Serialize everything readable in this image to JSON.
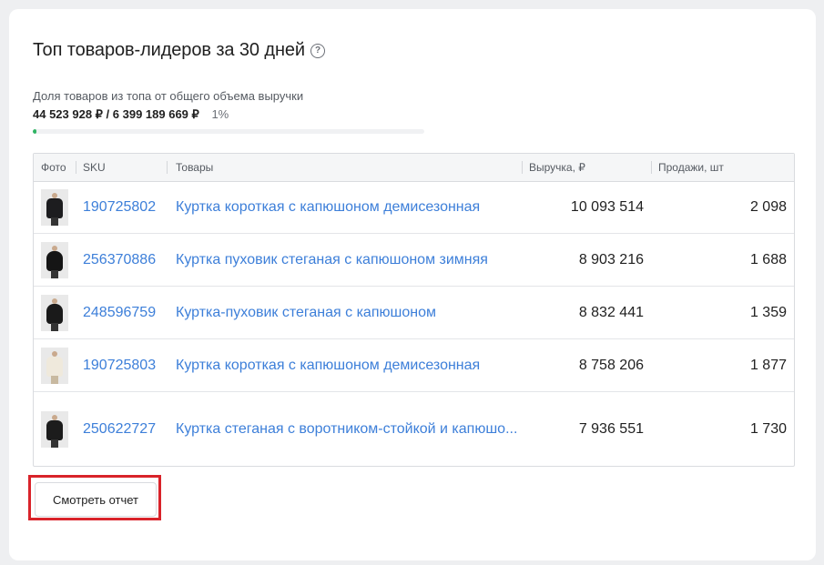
{
  "widget": {
    "title": "Топ товаров-лидеров за 30 дней",
    "help_icon": "question-circle-icon",
    "share_label": "Доля товаров из топа от общего объема выручки",
    "share_amount": "44 523 928 ₽ / 6 399 189 669 ₽",
    "share_percent": "1%",
    "share_fraction": 0.01,
    "accent_color": "#2fb463"
  },
  "table": {
    "columns": [
      "Фото",
      "SKU",
      "Товары",
      "Выручка, ₽",
      "Продажи, шт"
    ],
    "rows": [
      {
        "photo": "black-jacket-photo",
        "sku": "190725802",
        "name": "Куртка короткая с капюшоном демисезонная",
        "revenue": "10 093 514",
        "sales": "2 098"
      },
      {
        "photo": "black-puffer-photo",
        "sku": "256370886",
        "name": "Куртка пуховик стеганая с капюшоном зимняя",
        "revenue": "8 903 216",
        "sales": "1 688"
      },
      {
        "photo": "black-puffer-photo",
        "sku": "248596759",
        "name": "Куртка-пуховик стеганая с капюшоном",
        "revenue": "8 832 441",
        "sales": "1 359"
      },
      {
        "photo": "white-jacket-photo",
        "sku": "190725803",
        "name": "Куртка короткая с капюшоном демисезонная",
        "revenue": "8 758 206",
        "sales": "1 877"
      },
      {
        "photo": "black-quilted-jacket-photo",
        "sku": "250622727",
        "name": "Куртка стеганая с воротником-стойкой и капюшо...",
        "revenue": "7 936 551",
        "sales": "1 730"
      }
    ]
  },
  "actions": {
    "report_button": "Смотреть отчет"
  },
  "colors": {
    "link": "#3d7fd9",
    "highlight": "#d9232a"
  }
}
